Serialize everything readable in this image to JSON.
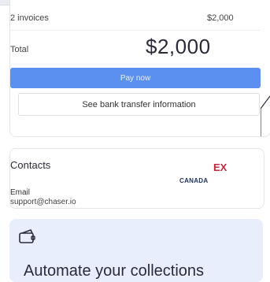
{
  "summary": {
    "invoice_count": "2 invoices",
    "invoice_amount": "$2,000",
    "total_label": "Total",
    "total_amount": "$2,000",
    "pay_button": "Pay now",
    "bank_button": "See bank transfer information"
  },
  "contacts": {
    "title": "Contacts",
    "flag_text": "EX",
    "country": "CANADA",
    "email_label": "Email",
    "email_value": "support@chaser.io"
  },
  "payments_card": {
    "icon": "credit-card-icon",
    "text": "Automate your collections"
  },
  "colors": {
    "accent": "#5b8ff0",
    "card_tint": "#e8eefb",
    "flag_red": "#c0283f",
    "country_navy": "#1d2f5e"
  }
}
